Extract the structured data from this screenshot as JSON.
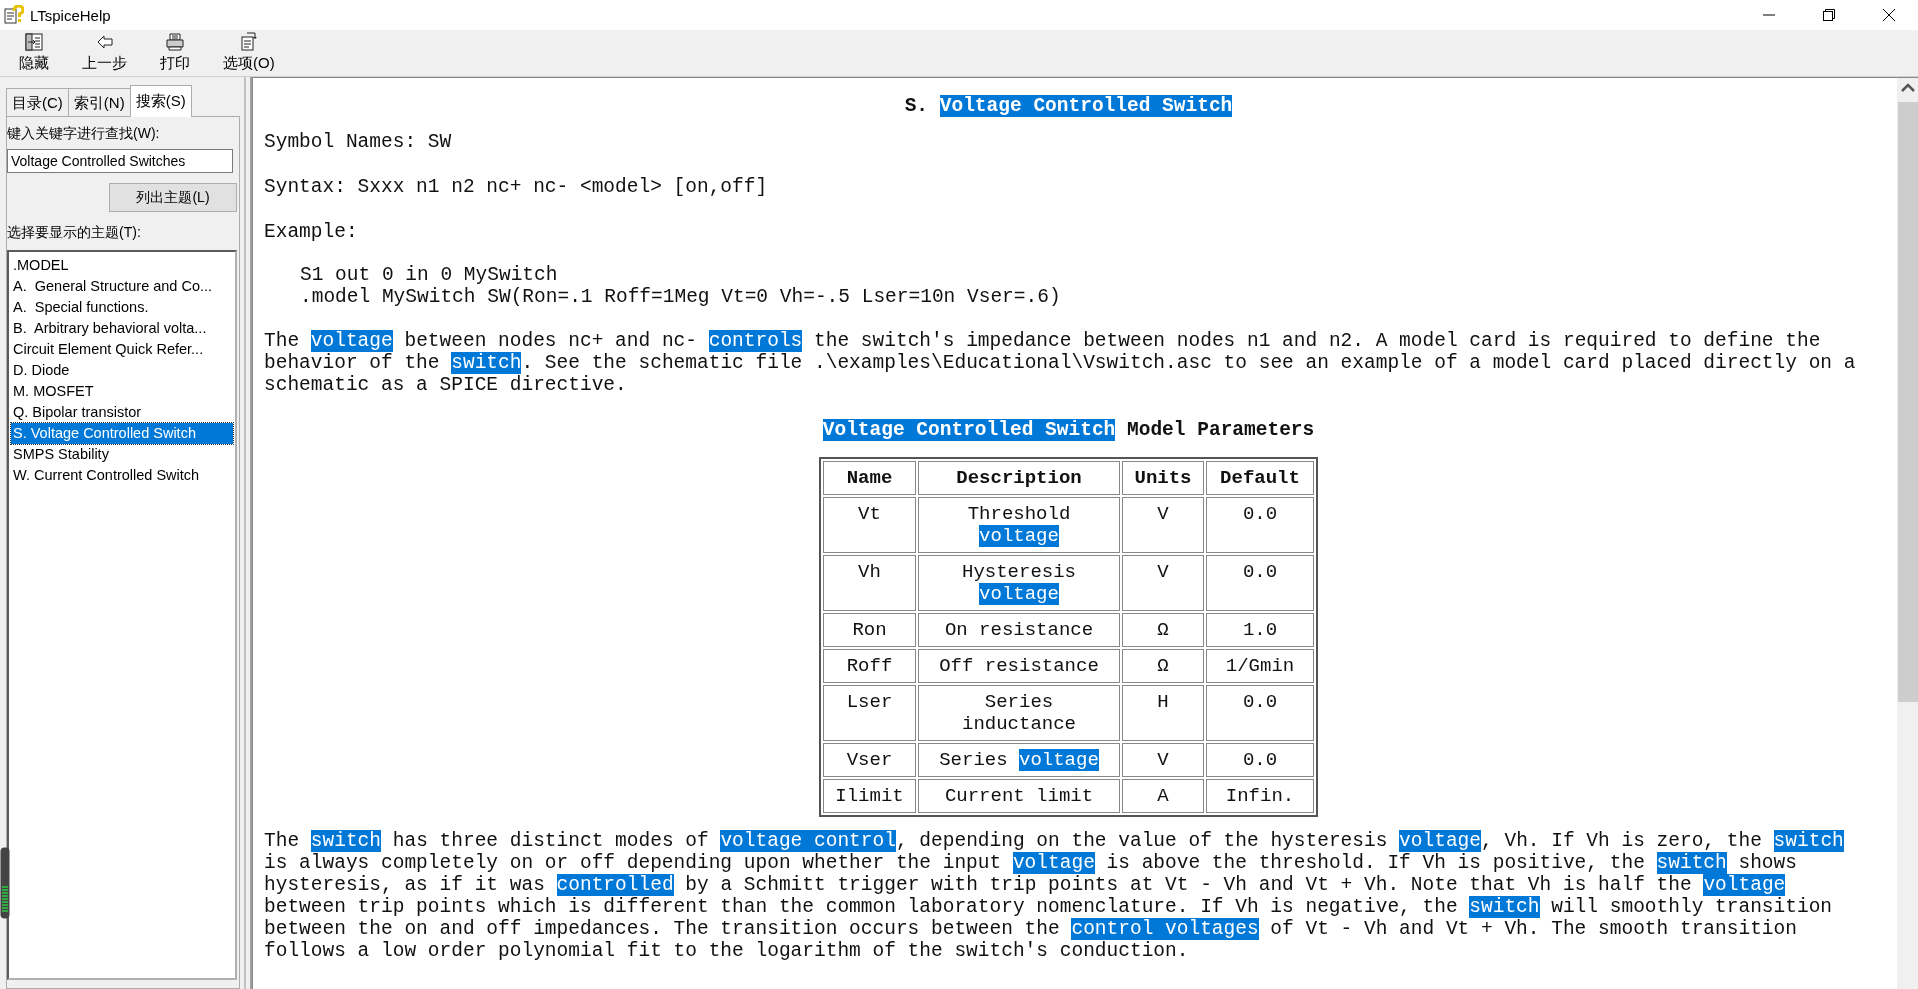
{
  "window": {
    "title": "LTspiceHelp"
  },
  "toolbar": [
    {
      "kind": "hide",
      "label": "隐藏"
    },
    {
      "kind": "back",
      "label": "上一步"
    },
    {
      "kind": "print",
      "label": "打印"
    },
    {
      "kind": "options",
      "label": "选项(O)"
    }
  ],
  "nav_tabs": [
    {
      "label": "目录(C)",
      "selected": false
    },
    {
      "label": "索引(N)",
      "selected": false
    },
    {
      "label": "搜索(S)",
      "selected": true
    }
  ],
  "search": {
    "label": "键入关键字进行查找(W):",
    "value": "Voltage Controlled Switches",
    "button": "列出主题(L)",
    "topics_label": "选择要显示的主题(T):"
  },
  "topics": [
    {
      "label": ".MODEL",
      "selected": false
    },
    {
      "label": "A.  General Structure and Co...",
      "selected": false
    },
    {
      "label": "A.  Special functions.",
      "selected": false
    },
    {
      "label": "B.  Arbitrary behavioral volta...",
      "selected": false
    },
    {
      "label": "Circuit Element Quick Refer...",
      "selected": false
    },
    {
      "label": "D. Diode",
      "selected": false
    },
    {
      "label": "M. MOSFET",
      "selected": false
    },
    {
      "label": "Q. Bipolar transistor",
      "selected": false
    },
    {
      "label": "S. Voltage Controlled Switch",
      "selected": true
    },
    {
      "label": "SMPS Stability",
      "selected": false
    },
    {
      "label": "W. Current Controlled Switch",
      "selected": false
    }
  ],
  "article": {
    "heading": [
      {
        "text": "S. ",
        "highlighted": false
      },
      {
        "text": "Voltage Controlled Switch",
        "highlighted": true
      }
    ],
    "symbol_names": "Symbol Names: SW",
    "syntax": "Syntax: Sxxx n1 n2 nc+ nc- <model> [on,off]",
    "example_label": "Example:",
    "example_code": [
      "S1 out 0 in 0 MySwitch",
      ".model MySwitch SW(Ron=.1 Roff=1Meg Vt=0 Vh=-.5 Lser=10n Vser=.6)"
    ],
    "intro": [
      {
        "text": "The ",
        "highlighted": false
      },
      {
        "text": "voltage",
        "highlighted": true
      },
      {
        "text": " between nodes nc+ and nc- ",
        "highlighted": false
      },
      {
        "text": "controls",
        "highlighted": true
      },
      {
        "text": " the switch's impedance between nodes n1 and n2. A model card is required to define the behavior of the ",
        "highlighted": false
      },
      {
        "text": "switch",
        "highlighted": true
      },
      {
        "text": ". See the schematic file .\\examples\\Educational\\Vswitch.asc to see an example of a model card placed directly on a schematic as a SPICE directive.",
        "highlighted": false
      }
    ],
    "table": {
      "caption": [
        {
          "text": "Voltage Controlled Switch",
          "highlighted": true
        },
        {
          "text": " Model Parameters",
          "highlighted": false
        }
      ],
      "columns": [
        "Name",
        "Description",
        "Units",
        "Default"
      ],
      "rows": [
        [
          [
            {
              "text": "Vt",
              "highlighted": false
            }
          ],
          [
            {
              "text": "Threshold ",
              "highlighted": false
            },
            {
              "text": "voltage",
              "highlighted": true
            }
          ],
          [
            {
              "text": "V",
              "highlighted": false
            }
          ],
          [
            {
              "text": "0.0",
              "highlighted": false
            }
          ]
        ],
        [
          [
            {
              "text": "Vh",
              "highlighted": false
            }
          ],
          [
            {
              "text": "Hysteresis ",
              "highlighted": false
            },
            {
              "text": "voltage",
              "highlighted": true
            }
          ],
          [
            {
              "text": "V",
              "highlighted": false
            }
          ],
          [
            {
              "text": "0.0",
              "highlighted": false
            }
          ]
        ],
        [
          [
            {
              "text": "Ron",
              "highlighted": false
            }
          ],
          [
            {
              "text": "On resistance",
              "highlighted": false
            }
          ],
          [
            {
              "text": "Ω",
              "highlighted": false
            }
          ],
          [
            {
              "text": "1.0",
              "highlighted": false
            }
          ]
        ],
        [
          [
            {
              "text": "Roff",
              "highlighted": false
            }
          ],
          [
            {
              "text": "Off resistance",
              "highlighted": false
            }
          ],
          [
            {
              "text": "Ω",
              "highlighted": false
            }
          ],
          [
            {
              "text": "1/Gmin",
              "highlighted": false
            }
          ]
        ],
        [
          [
            {
              "text": "Lser",
              "highlighted": false
            }
          ],
          [
            {
              "text": "Series inductance",
              "highlighted": false
            }
          ],
          [
            {
              "text": "H",
              "highlighted": false
            }
          ],
          [
            {
              "text": "0.0",
              "highlighted": false
            }
          ]
        ],
        [
          [
            {
              "text": "Vser",
              "highlighted": false
            }
          ],
          [
            {
              "text": "Series ",
              "highlighted": false
            },
            {
              "text": "voltage",
              "highlighted": true
            }
          ],
          [
            {
              "text": "V",
              "highlighted": false
            }
          ],
          [
            {
              "text": "0.0",
              "highlighted": false
            }
          ]
        ],
        [
          [
            {
              "text": "Ilimit",
              "highlighted": false
            }
          ],
          [
            {
              "text": "Current limit",
              "highlighted": false
            }
          ],
          [
            {
              "text": "A",
              "highlighted": false
            }
          ],
          [
            {
              "text": "Infin.",
              "highlighted": false
            }
          ]
        ]
      ]
    },
    "outro": [
      {
        "text": "The ",
        "highlighted": false
      },
      {
        "text": "switch",
        "highlighted": true
      },
      {
        "text": " has three distinct modes of ",
        "highlighted": false
      },
      {
        "text": "voltage control",
        "highlighted": true
      },
      {
        "text": ", depending on the value of the hysteresis ",
        "highlighted": false
      },
      {
        "text": "voltage",
        "highlighted": true
      },
      {
        "text": ", Vh. If Vh is zero, the ",
        "highlighted": false
      },
      {
        "text": "switch",
        "highlighted": true
      },
      {
        "text": " is always completely on or off depending upon whether the input ",
        "highlighted": false
      },
      {
        "text": "voltage",
        "highlighted": true
      },
      {
        "text": " is above the threshold. If Vh is positive, the ",
        "highlighted": false
      },
      {
        "text": "switch",
        "highlighted": true
      },
      {
        "text": " shows hysteresis, as if it was ",
        "highlighted": false
      },
      {
        "text": "controlled",
        "highlighted": true
      },
      {
        "text": " by a Schmitt trigger with trip points at Vt - Vh and Vt + Vh. Note that Vh is half the ",
        "highlighted": false
      },
      {
        "text": "voltage",
        "highlighted": true
      },
      {
        "text": " between trip points which is different than the common laboratory nomenclature. If Vh is negative, the ",
        "highlighted": false
      },
      {
        "text": "switch",
        "highlighted": true
      },
      {
        "text": " will smoothly transition between the on and off impedances. The transition occurs between the ",
        "highlighted": false
      },
      {
        "text": "control voltages",
        "highlighted": true
      },
      {
        "text": " of Vt - Vh and Vt + Vh. The smooth transition follows a low order polynomial fit to the logarithm of the switch's conduction.",
        "highlighted": false
      }
    ]
  }
}
